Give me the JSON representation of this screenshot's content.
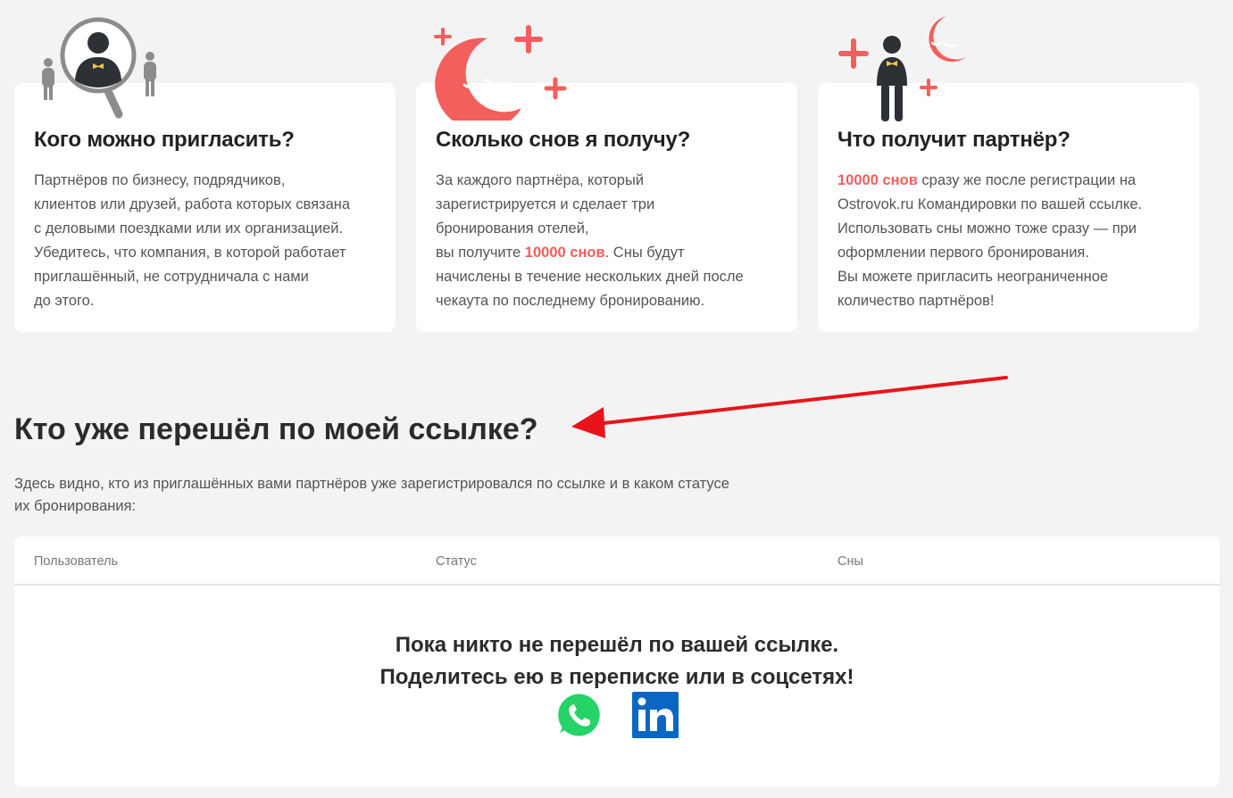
{
  "cards": [
    {
      "title": "Кого можно пригласить?",
      "text": "Партнёров по бизнесу, подрядчиков,\nклиентов или друзей, работа которых связана\nс деловыми поездками или их организацией.\nУбедитесь, что компания, в которой работает\nприглашённый, не сотрудничала с нами\nдо этого.",
      "illustration": "magnifier-people-icon"
    },
    {
      "title": "Сколько снов я получу?",
      "text_before": "За каждого партнёра, который\nзарегистрируется и сделает три\nбронирования отелей,\nвы получите ",
      "accent": "10000 снов",
      "text_after": ". Сны будут\nначислены в течение нескольких дней после\nчекаута по последнему бронированию.",
      "illustration": "sleeping-moon-icon"
    },
    {
      "title": "Что получит партнёр?",
      "accent": "10000  снов",
      "text_after": " сразу же после регистрации на\nOstrovok.ru Командировки по вашей ссылке.\nИспользовать сны можно тоже сразу — при\nоформлении первого бронирования.\nВы можете пригласить неограниченное\nколичество партнёров!",
      "illustration": "partner-moon-icon"
    }
  ],
  "section": {
    "title": "Кто уже перешёл по моей ссылке?",
    "description": "Здесь видно, кто из приглашённых вами партнёров уже зарегистрировался по ссылке и в каком статусе их бронирования:"
  },
  "table": {
    "columns": [
      "Пользователь",
      "Статус",
      "Сны"
    ],
    "empty_line1": "Пока никто не перешёл по вашей ссылке.",
    "empty_line2": "Поделитесь ею в переписке или в соцсетях!"
  },
  "share": [
    {
      "name": "whatsapp-icon",
      "color": "#25d366"
    },
    {
      "name": "linkedin-icon",
      "color": "#0a66c2"
    }
  ],
  "colors": {
    "accent": "#f25f5c",
    "annotation_arrow": "#e8141a"
  }
}
